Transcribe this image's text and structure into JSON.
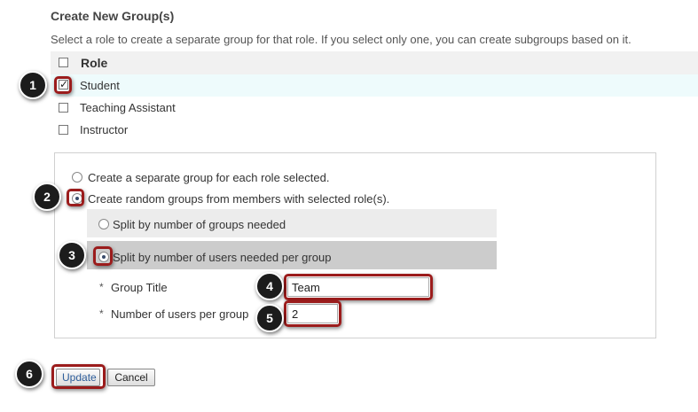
{
  "section": {
    "title": "Create New Group(s)",
    "description": "Select a role to create a separate group for that role. If you select only one, you can create subgroups based on it."
  },
  "roles": {
    "header": "Role",
    "items": [
      {
        "label": "Student",
        "checked": true
      },
      {
        "label": "Teaching Assistant",
        "checked": false
      },
      {
        "label": "Instructor",
        "checked": false
      }
    ]
  },
  "options": {
    "separate": "Create a separate group for each role selected.",
    "random": "Create random groups from members with selected role(s).",
    "split_groups": "Split by number of groups needed",
    "split_users": "Split by number of users needed per group"
  },
  "fields": {
    "required_mark": "*",
    "group_title_label": "Group Title",
    "group_title_value": "Team",
    "users_label": "Number of users per group",
    "users_value": "2"
  },
  "buttons": {
    "update": "Update",
    "cancel": "Cancel"
  },
  "callouts": [
    "1",
    "2",
    "3",
    "4",
    "5",
    "6"
  ],
  "colors": {
    "highlight": "#9b1c1c",
    "badge": "#1c1c1c",
    "selected_row": "#eefbfc"
  }
}
